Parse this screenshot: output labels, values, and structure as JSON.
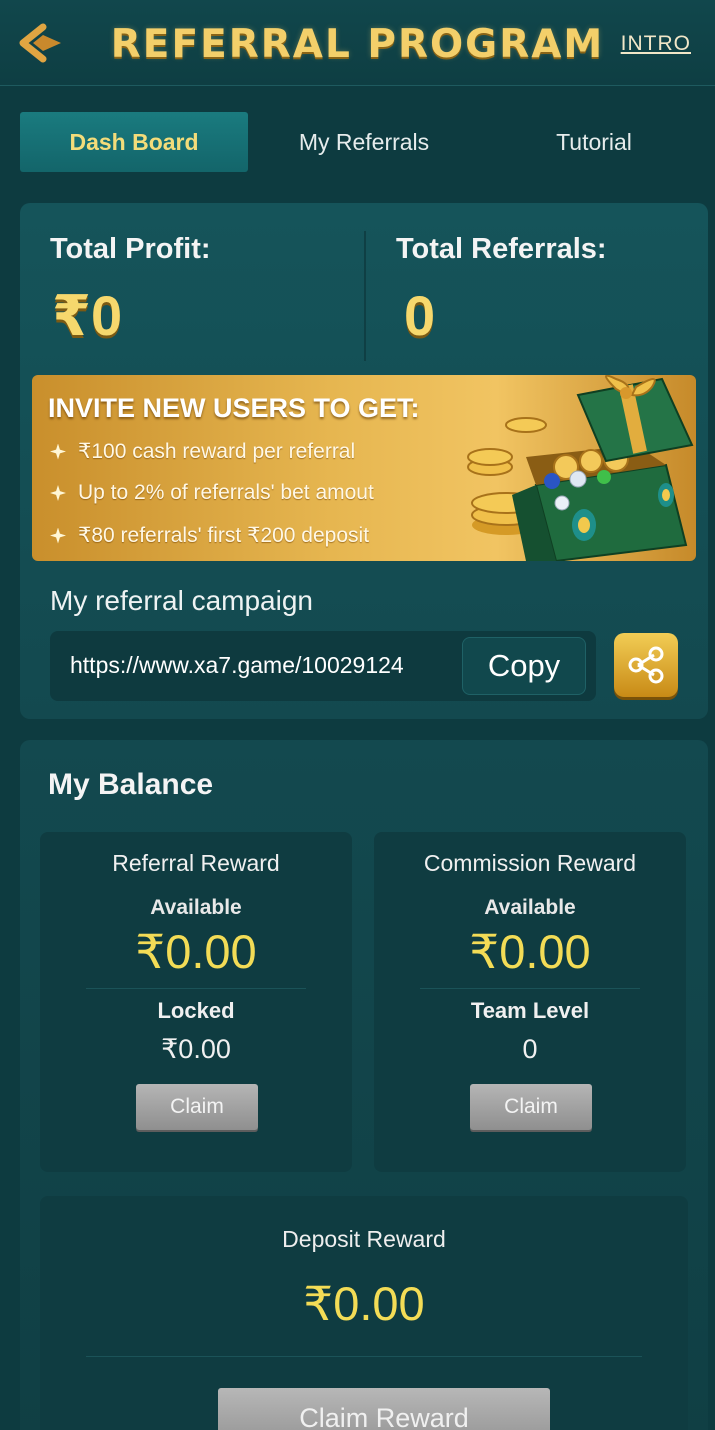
{
  "header": {
    "title": "REFERRAL PROGRAM",
    "intro_label": "INTRO"
  },
  "tabs": [
    {
      "label": "Dash Board",
      "active": true
    },
    {
      "label": "My Referrals",
      "active": false
    },
    {
      "label": "Tutorial",
      "active": false
    }
  ],
  "stats": {
    "total_profit_label": "Total Profit:",
    "total_profit_value": "₹0",
    "total_referrals_label": "Total Referrals:",
    "total_referrals_value": "0"
  },
  "banner": {
    "title": "INVITE NEW USERS TO GET:",
    "lines": [
      "₹100  cash reward per referral",
      "Up to 2% of referrals' bet amout",
      "₹80 referrals' first ₹200 deposit"
    ]
  },
  "campaign": {
    "label": "My referral campaign",
    "link": "https://www.xa7.game/10029124",
    "copy_label": "Copy"
  },
  "balance": {
    "title": "My Balance",
    "referral": {
      "title": "Referral Reward",
      "available_label": "Available",
      "available_value": "₹0.00",
      "locked_label": "Locked",
      "locked_value": "₹0.00",
      "claim_label": "Claim"
    },
    "commission": {
      "title": "Commission Reward",
      "available_label": "Available",
      "available_value": "₹0.00",
      "team_level_label": "Team Level",
      "team_level_value": "0",
      "claim_label": "Claim"
    },
    "deposit": {
      "title": "Deposit Reward",
      "amount": "₹0.00",
      "claim_label": "Claim Reward"
    }
  },
  "colors": {
    "background": "#0d3b40",
    "gold": "#f3cf6a",
    "amount_yellow": "#f3dc56",
    "tab_active": "#13656a"
  }
}
